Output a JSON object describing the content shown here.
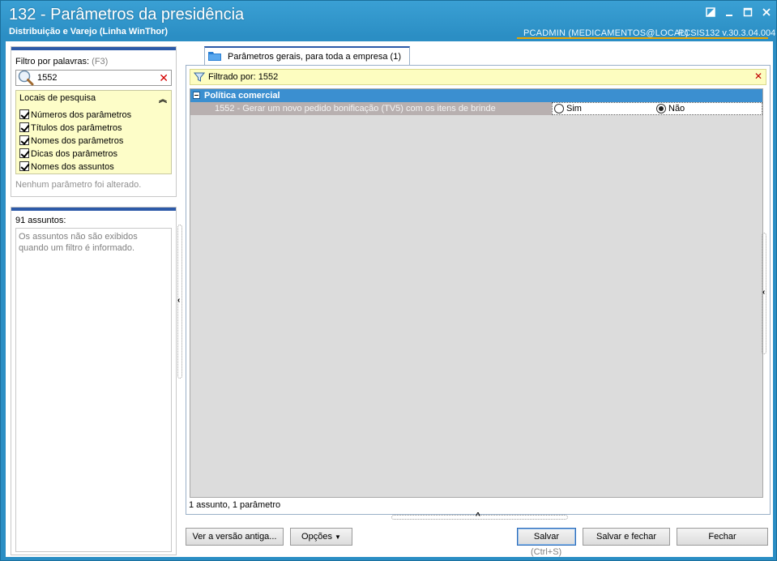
{
  "window": {
    "title": "132 - Parâmetros da presidência",
    "subtitle": "Distribuição e Varejo (Linha WinThor)",
    "user": "PCADMIN (MEDICAMENTOS@LOCAL)",
    "version": "PCSIS132  v.30.3.04.004"
  },
  "filter_panel": {
    "label": "Filtro por palavras:",
    "shortcut": "(F3)",
    "search_value": "1552",
    "locais_title": "Locais de pesquisa",
    "options": [
      "Números dos parâmetros",
      "Títulos dos parâmetros",
      "Nomes dos parâmetros",
      "Dicas dos parâmetros",
      "Nomes dos assuntos"
    ],
    "status": "Nenhum parâmetro foi alterado."
  },
  "subjects_panel": {
    "count_label": "91 assuntos:",
    "message": "Os assuntos não são exibidos quando um filtro é informado."
  },
  "tab": {
    "label": "Parâmetros gerais, para toda a empresa  (1)"
  },
  "filter_bar": {
    "text": "Filtrado por: 1552"
  },
  "grid": {
    "group_title": "Política comercial",
    "param_label": "1552 - Gerar um  novo pedido bonificação (TV5) com os itens de brinde",
    "option_yes": "Sim",
    "option_no": "Não",
    "selected": "Não"
  },
  "status_line": "1 assunto, 1 parâmetro",
  "buttons": {
    "old_version": "Ver a versão antiga...",
    "options": "Opções",
    "save": "Salvar",
    "save_close": "Salvar e fechar",
    "close": "Fechar",
    "save_hotkey": "(Ctrl+S)"
  },
  "colors": {
    "titlebar": "#2b8ec4",
    "group_header": "#3b8fd0",
    "filter_highlight": "#fdfdc0",
    "user_underline": "#e8a600"
  }
}
